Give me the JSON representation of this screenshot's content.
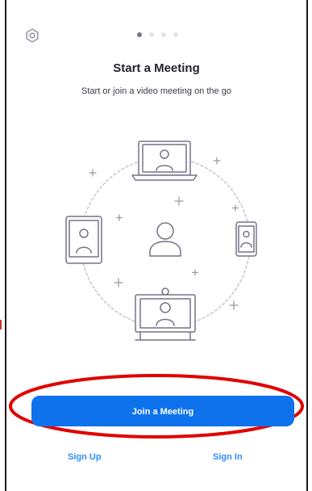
{
  "onboarding": {
    "title": "Start a Meeting",
    "subtitle": "Start or join a video meeting on the go",
    "page_indicator": {
      "current": 1,
      "total": 4
    }
  },
  "actions": {
    "join_label": "Join a Meeting",
    "signup_label": "Sign Up",
    "signin_label": "Sign In"
  },
  "icons": {
    "settings": "gear-icon"
  },
  "colors": {
    "accent": "#0e72ed",
    "link": "#2d8cff",
    "annotation": "#e00000",
    "illustration_stroke": "#747487"
  }
}
